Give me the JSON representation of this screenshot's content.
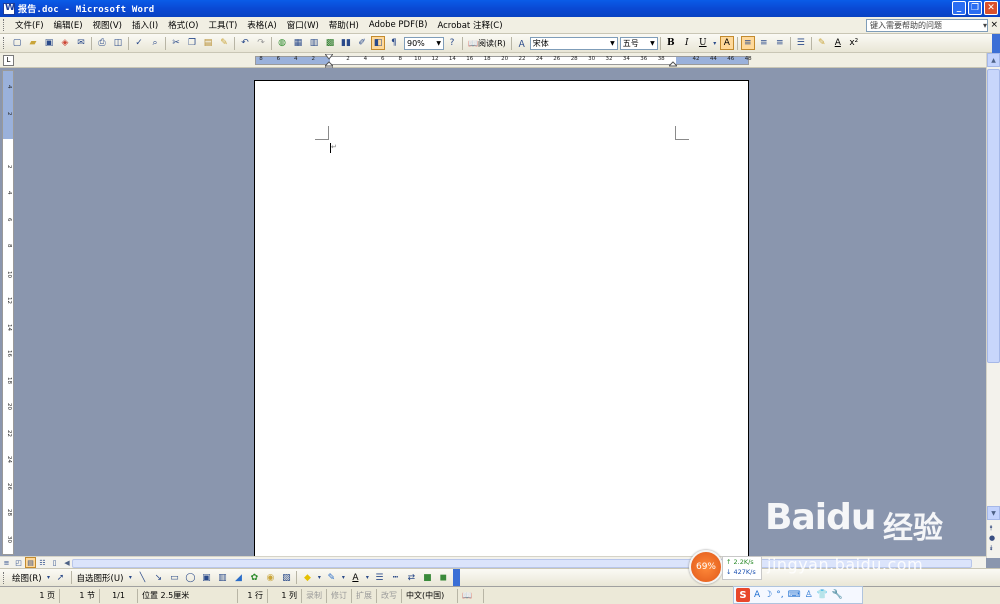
{
  "window": {
    "title": "报告.doc - Microsoft Word",
    "minimize": "_",
    "restore": "❐",
    "close": "✕"
  },
  "menu": {
    "items": [
      "文件(F)",
      "编辑(E)",
      "视图(V)",
      "插入(I)",
      "格式(O)",
      "工具(T)",
      "表格(A)",
      "窗口(W)",
      "帮助(H)",
      "Adobe PDF(B)",
      "Acrobat 注释(C)"
    ],
    "help_placeholder": "键入需要帮助的问题",
    "help_close": "×"
  },
  "toolbar": {
    "zoom": "90%",
    "read_label": "阅读(R)",
    "font_name": "宋体",
    "font_size": "五号",
    "bold": "B",
    "italic": "I",
    "underline": "U",
    "highlight": "A",
    "font_color": "A",
    "superscript": "x²"
  },
  "ruler": {
    "tab_selector": "L",
    "ticks": [
      "8",
      "6",
      "4",
      "2",
      "",
      "2",
      "4",
      "6",
      "8",
      "10",
      "12",
      "14",
      "16",
      "18",
      "20",
      "22",
      "24",
      "26",
      "28",
      "30",
      "32",
      "34",
      "36",
      "38",
      "",
      "42",
      "44",
      "46",
      "48"
    ],
    "v_ticks": [
      "4",
      "2",
      "",
      "2",
      "4",
      "6",
      "8",
      "10",
      "12",
      "14",
      "16",
      "18",
      "20",
      "22",
      "24",
      "26",
      "28",
      "30",
      "32"
    ]
  },
  "drawing": {
    "draw_label": "绘图(R)",
    "autoshape_label": "自选图形(U)"
  },
  "status": {
    "page": "1 页",
    "section": "1 节",
    "page_of": "1/1",
    "position": "位置 2.5厘米",
    "line": "1 行",
    "col": "1 列",
    "rec": "录制",
    "trk": "修订",
    "ext": "扩展",
    "ovr": "改写",
    "lang": "中文(中国)"
  },
  "net": {
    "percent": "69%",
    "up": "2.2K/s",
    "down": "427K/s"
  },
  "watermark": {
    "brand": "Baidu",
    "brand_cn": "经验",
    "url": "jingyan.baidu.com"
  },
  "colors": {
    "titlebar": "#0a5ce8",
    "workspace": "#8a96ae",
    "menubar": "#f1efe3"
  }
}
